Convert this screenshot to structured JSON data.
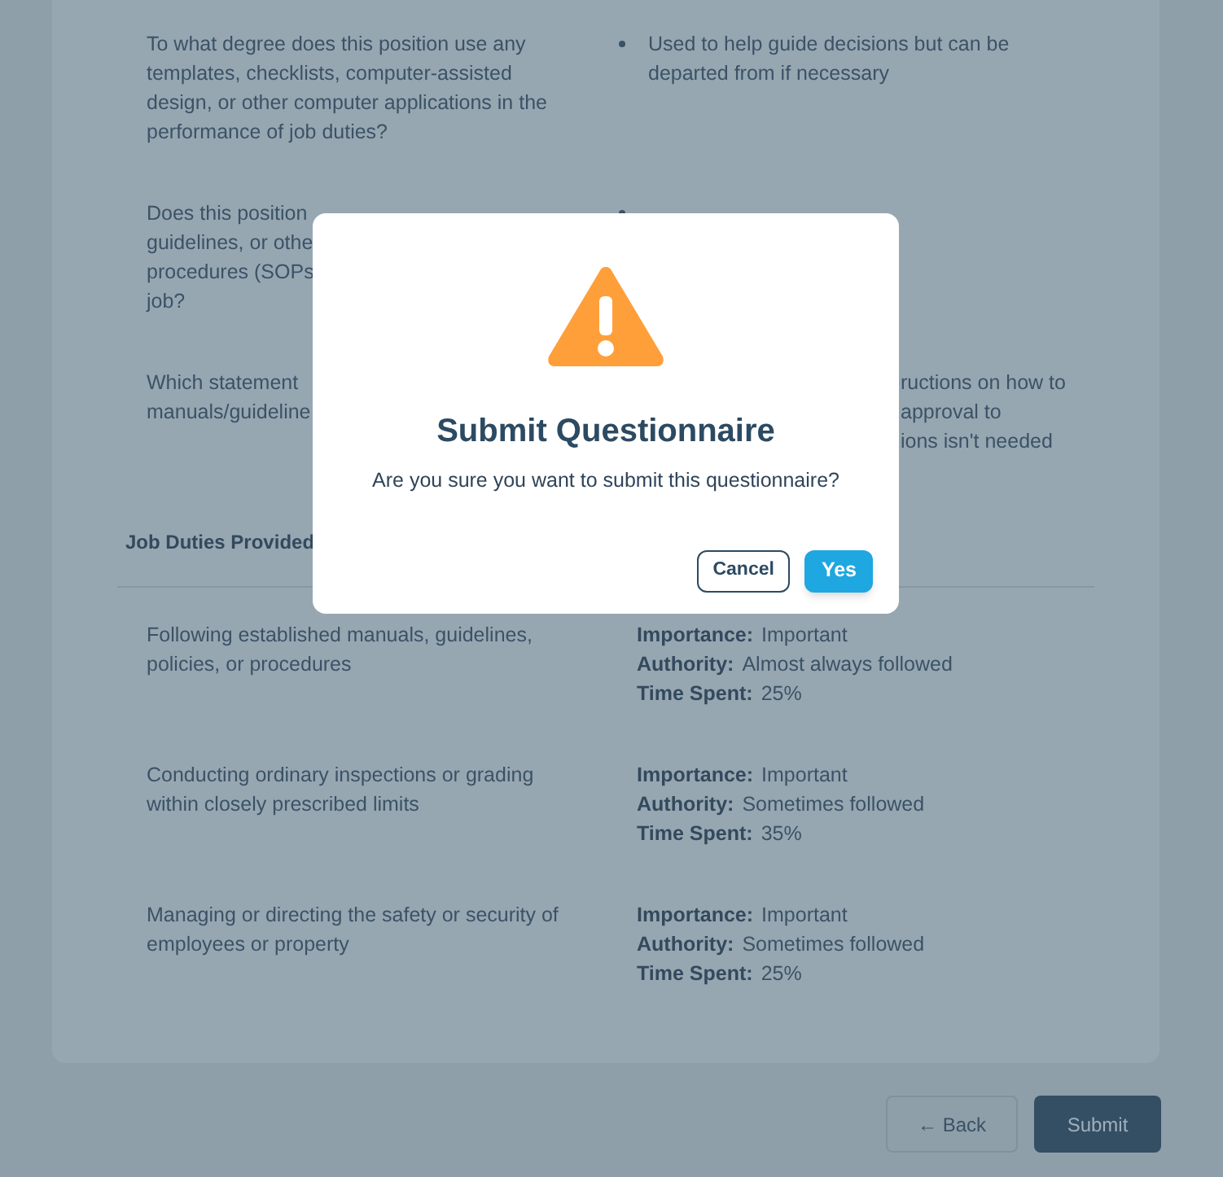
{
  "questions": [
    {
      "question_lines": [
        "To what degree does this position use any",
        "templates, checklists, computer-assisted",
        "design, or other computer applications in the",
        "performance of job duties?"
      ],
      "answer_lines": [
        "Used to help guide decisions but can be",
        "departed from if necessary"
      ],
      "kind": "bulleted"
    },
    {
      "question_lines": [
        "Does this position",
        "guidelines, or othe",
        "procedures (SOPs",
        "job?"
      ],
      "kind": "bulleted"
    },
    {
      "question_lines": [
        "Which statement",
        "manuals/guideline"
      ],
      "answer_lines": [
        "ructions on how to",
        "approval to",
        "ions isn't needed"
      ],
      "kind": "fragment"
    }
  ],
  "section_title": "Job Duties Provided",
  "duties": [
    {
      "duty": "Following established manuals, guidelines, policies, or procedures",
      "fields": [
        {
          "label": "Importance:",
          "value": "Important"
        },
        {
          "label": "Authority:",
          "value": "Almost always followed"
        },
        {
          "label": "Time Spent:",
          "value": "25%"
        }
      ]
    },
    {
      "duty": "Conducting ordinary inspections or grading within closely prescribed limits",
      "fields": [
        {
          "label": "Importance:",
          "value": "Important"
        },
        {
          "label": "Authority:",
          "value": "Sometimes followed"
        },
        {
          "label": "Time Spent:",
          "value": "35%"
        }
      ]
    },
    {
      "duty": "Managing or directing the safety or security of employees or property",
      "fields": [
        {
          "label": "Importance:",
          "value": "Important"
        },
        {
          "label": "Authority:",
          "value": "Sometimes followed"
        },
        {
          "label": "Time Spent:",
          "value": "25%"
        }
      ]
    }
  ],
  "footer_buttons": [
    {
      "label": "← Back",
      "kind": "secondary"
    },
    {
      "label": "Submit",
      "kind": "primary"
    }
  ],
  "dialog": {
    "title": "Submit Questionnaire",
    "message": "Are you sure you want to submit this questionnaire?",
    "buttons": [
      {
        "label": "Cancel",
        "kind": "secondary"
      },
      {
        "label": "Yes",
        "kind": "primary"
      }
    ]
  }
}
